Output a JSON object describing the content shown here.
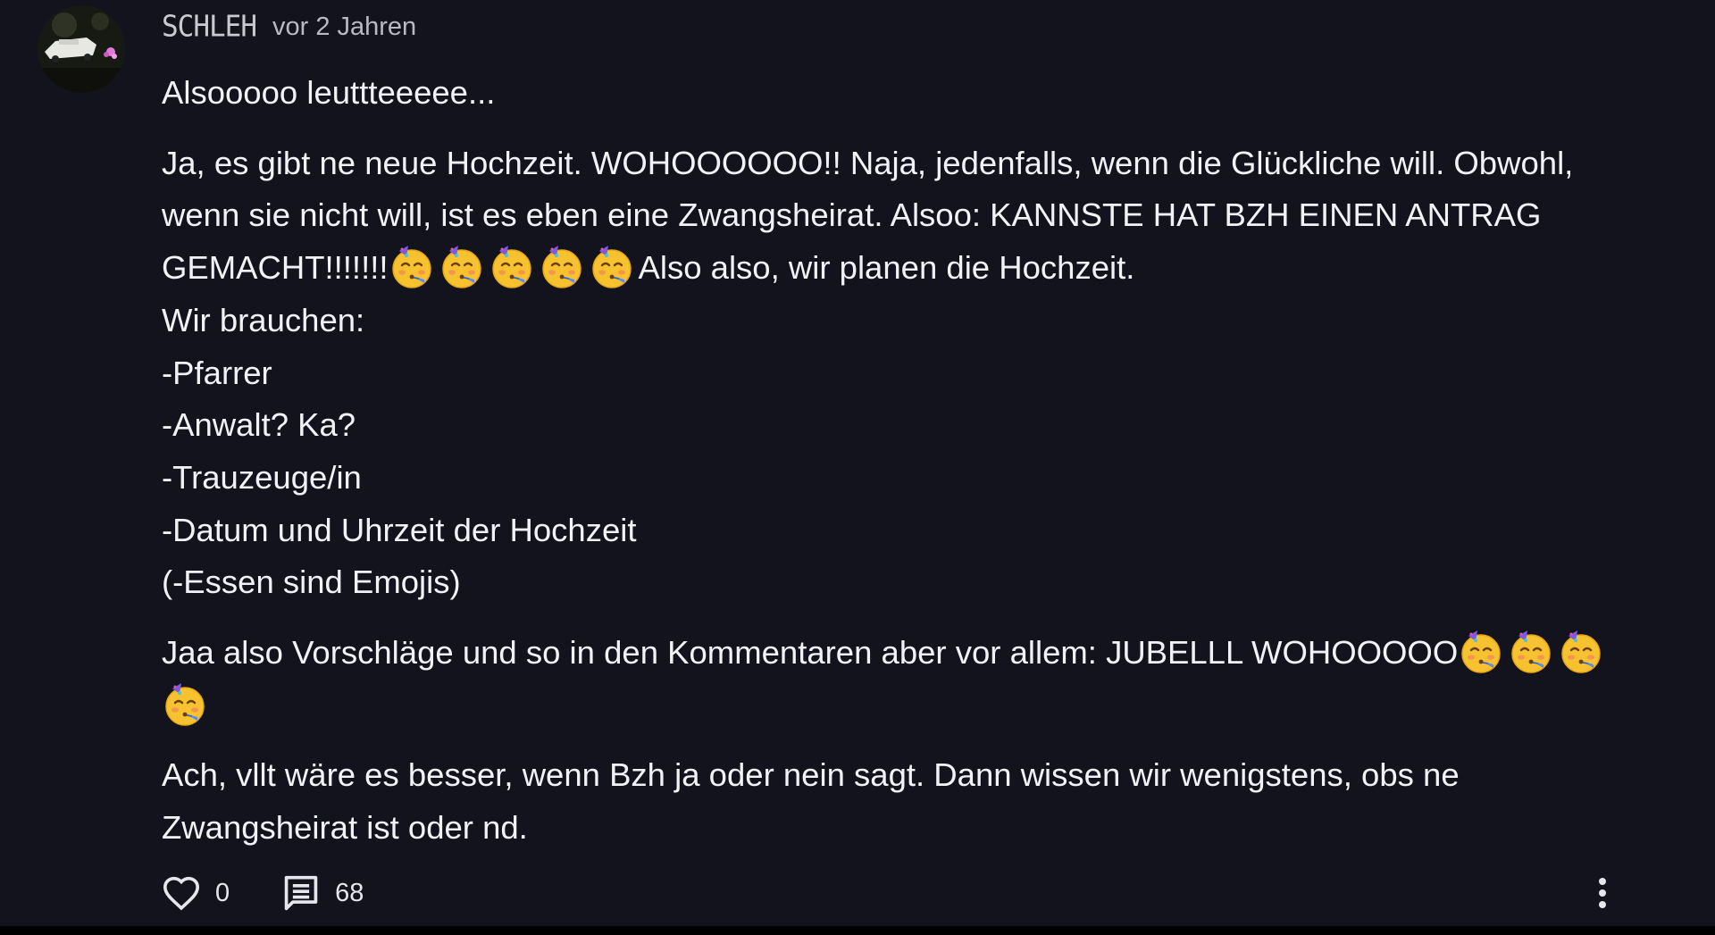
{
  "comment": {
    "author": "SCHLEH",
    "time": "vor 2 Jahren",
    "emoji_icon": "partying-face-emoji",
    "paragraphs": [
      {
        "runs": [
          {
            "text": "Alsooooo leuttteeeee..."
          }
        ]
      },
      {
        "runs": [
          {
            "text": "Ja, es gibt ne neue Hochzeit. WOHOOOOOO!! Naja, jedenfalls, wenn die Glückliche will. Obwohl, wenn sie nicht will, ist es eben eine Zwangsheirat. Alsoo: KANNSTE HAT BZH EINEN ANTRAG GEMACHT!!!!!!!"
          },
          {
            "emoji": 5
          },
          {
            "text": "Also also, wir planen die Hochzeit.\nWir brauchen:\n-Pfarrer\n-Anwalt? Ka?\n-Trauzeuge/in\n-Datum und Uhrzeit der Hochzeit\n(-Essen sind Emojis)"
          }
        ]
      },
      {
        "runs": [
          {
            "text": "Jaa also Vorschläge und so in den Kommentaren aber vor allem: JUBELLL WOHOOOOO"
          },
          {
            "emoji": 4
          }
        ]
      },
      {
        "runs": [
          {
            "text": "Ach, vllt wäre es besser, wenn Bzh ja oder nein sagt. Dann wissen wir wenigstens, obs ne Zwangsheirat ist oder nd."
          }
        ]
      }
    ],
    "actions": {
      "likes": "0",
      "replies": "68",
      "like_icon": "heart-icon",
      "reply_icon": "comment-icon",
      "more_icon": "more-vertical-icon"
    }
  },
  "colors": {
    "background": "#13131d",
    "text": "#f2f2f6",
    "muted": "#b9b9c3"
  }
}
